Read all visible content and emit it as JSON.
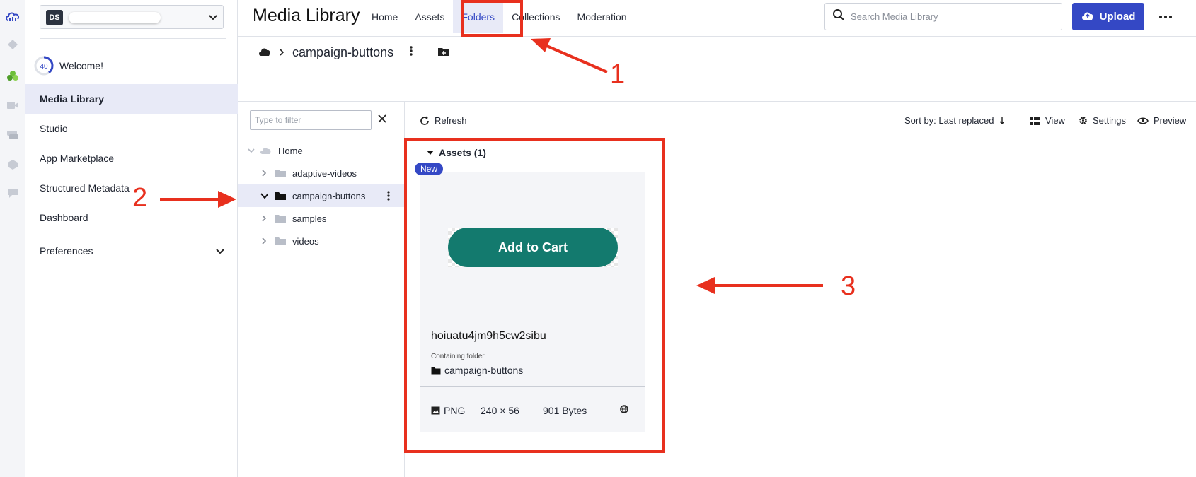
{
  "header": {
    "title": "Media Library",
    "tabs": [
      "Home",
      "Assets",
      "Folders",
      "Collections",
      "Moderation"
    ],
    "active_tab": "Folders",
    "search_placeholder": "Search Media Library",
    "upload_label": "Upload"
  },
  "sidebar": {
    "workspace_initials": "DS",
    "welcome_progress": "40",
    "welcome_label": "Welcome!",
    "items": [
      "Media Library",
      "Studio",
      "App Marketplace",
      "Structured Metadata",
      "Dashboard",
      "Preferences"
    ],
    "active_item": "Media Library"
  },
  "breadcrumb": {
    "current": "campaign-buttons"
  },
  "tree": {
    "filter_placeholder": "Type to filter",
    "root": "Home",
    "folders": [
      "adaptive-videos",
      "campaign-buttons",
      "samples",
      "videos"
    ],
    "selected": "campaign-buttons"
  },
  "toolbar": {
    "refresh": "Refresh",
    "sort": "Sort by: Last replaced",
    "view": "View",
    "settings": "Settings",
    "preview": "Preview"
  },
  "assets": {
    "heading": "Assets (1)",
    "badge": "New",
    "thumbnail_text": "Add to Cart",
    "thumbnail_color": "#137a6e",
    "name": "hoiuatu4jm9h5cw2sibu",
    "containing_folder_label": "Containing folder",
    "containing_folder": "campaign-buttons",
    "format": "PNG",
    "dimensions": "240 × 56",
    "size": "901 Bytes"
  },
  "annotations": {
    "labels": [
      "1",
      "2",
      "3"
    ],
    "color": "#e8301e"
  },
  "colors": {
    "accent": "#3448c5",
    "active_bg": "#e8eaf7"
  }
}
